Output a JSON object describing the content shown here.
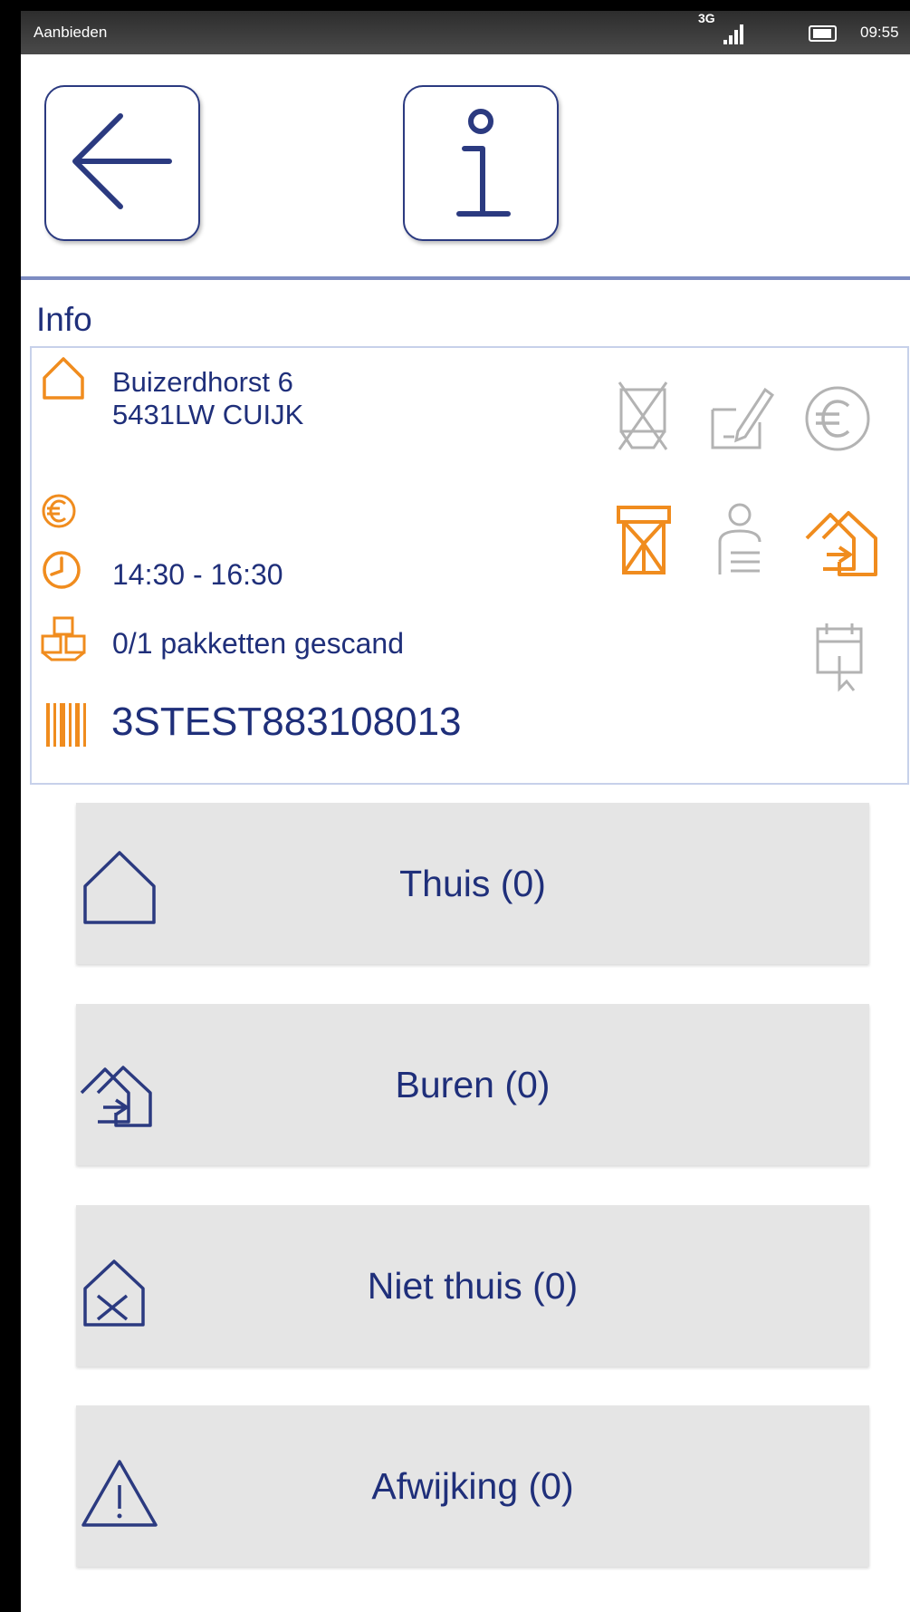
{
  "status_bar": {
    "title": "Aanbieden",
    "network": "3G",
    "time": "09:55"
  },
  "toolbar": {
    "back_icon": "arrow-left-icon",
    "info_icon": "info-icon"
  },
  "info": {
    "title": "Info",
    "address_line1": "Buizerdhorst 6",
    "address_line2": "5431LW CUIJK",
    "time_window": "14:30 - 16:30",
    "packages_status": "0/1 pakketten gescand",
    "barcode": "3STEST883108013"
  },
  "actions": [
    {
      "label": "Thuis (0)",
      "icon": "home-icon"
    },
    {
      "label": "Buren (0)",
      "icon": "neighbours-icon"
    },
    {
      "label": "Niet thuis (0)",
      "icon": "not-home-icon"
    },
    {
      "label": "Afwijking (0)",
      "icon": "warning-icon"
    }
  ],
  "colors": {
    "primary": "#1f2f7a",
    "accent": "#f08c1e",
    "disabled": "#b3b3b3",
    "button_bg": "#e5e5e5"
  }
}
